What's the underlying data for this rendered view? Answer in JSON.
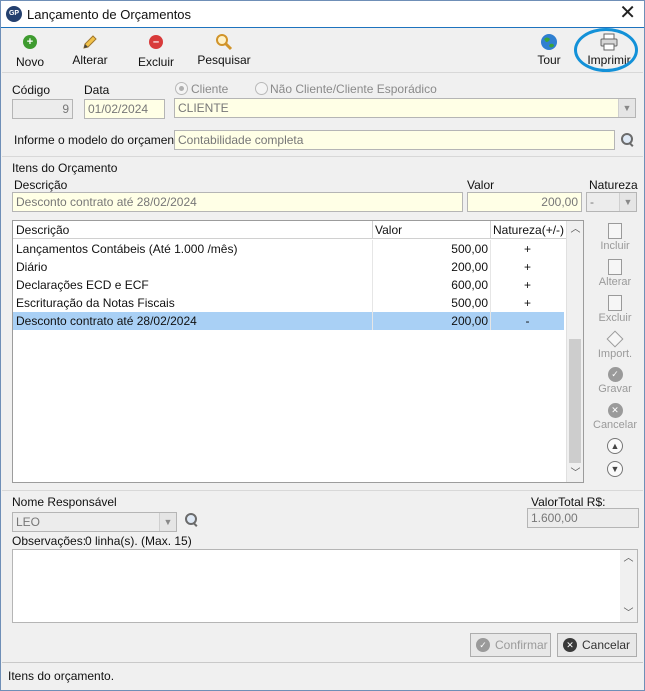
{
  "window": {
    "title": "Lançamento de Orçamentos",
    "app_icon_text": "GP"
  },
  "toolbar": {
    "novo": "Novo",
    "alterar": "Alterar",
    "excluir": "Excluir",
    "pesquisar": "Pesquisar",
    "tour": "Tour",
    "imprimir": "Imprimir"
  },
  "header": {
    "codigo_label": "Código",
    "codigo_value": "9",
    "data_label": "Data",
    "data_value": "01/02/2024",
    "radio_cliente": "Cliente",
    "radio_nao_cliente": "Não Cliente/Cliente Esporádico",
    "cliente_value": "CLIENTE",
    "modelo_label": "Informe o modelo do orçamento:",
    "modelo_value": "Contabilidade completa"
  },
  "itens": {
    "section_title": "Itens do Orçamento",
    "descricao_label": "Descrição",
    "valor_label": "Valor",
    "natureza_label": "Natureza",
    "descricao_value": "Desconto contrato até 28/02/2024",
    "valor_value": "200,00",
    "natureza_value": "-"
  },
  "grid": {
    "columns": [
      "Descrição",
      "Valor",
      "Natureza(+/-)"
    ],
    "rows": [
      {
        "descricao": "Lançamentos Contábeis (Até 1.000 /mês)",
        "valor": "500,00",
        "natureza": "+"
      },
      {
        "descricao": "Diário",
        "valor": "200,00",
        "natureza": "+"
      },
      {
        "descricao": "Declarações ECD e ECF",
        "valor": "600,00",
        "natureza": "+"
      },
      {
        "descricao": "Escrituração da Notas Fiscais",
        "valor": "500,00",
        "natureza": "+"
      },
      {
        "descricao": "Desconto contrato até 28/02/2024",
        "valor": "200,00",
        "natureza": "-"
      }
    ],
    "selected_row": 4
  },
  "side_buttons": {
    "incluir": "Incluir",
    "alterar": "Alterar",
    "excluir": "Excluir",
    "importar": "Import.",
    "gravar": "Gravar",
    "cancelar": "Cancelar"
  },
  "footer": {
    "responsavel_label": "Nome Responsável",
    "responsavel_value": "LEO",
    "valor_total_label": "ValorTotal R$:",
    "valor_total_value": "1.600,00",
    "observacoes_label": "Observações:",
    "observacoes_info": "0 linha(s). (Max. 15)",
    "confirmar": "Confirmar",
    "cancelar": "Cancelar"
  },
  "status": {
    "text": "Itens do orçamento."
  },
  "colors": {
    "accent": "#1391d8",
    "selected_row": "#a9d0f5",
    "field_bg": "#ffffe6"
  },
  "icons": [
    "plus-circle-icon",
    "pencil-icon",
    "minus-circle-icon",
    "magnifier-icon",
    "globe-icon",
    "printer-icon"
  ]
}
